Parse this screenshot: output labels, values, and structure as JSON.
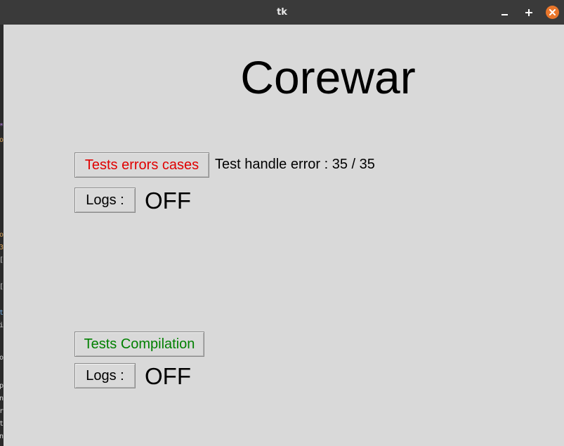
{
  "window": {
    "title": "tk",
    "controls": {
      "minimize_icon": "minimize-icon",
      "maximize_icon": "maximize-icon",
      "close_icon": "close-icon",
      "close_color": "#e9762b"
    }
  },
  "app": {
    "heading": "Corewar"
  },
  "error_tests": {
    "button_label": "Tests errors cases",
    "button_color": "#e00000",
    "result_text": "Test handle error : 35 / 35",
    "logs_button_label": "Logs :",
    "logs_state": "OFF"
  },
  "compilation_tests": {
    "button_label": "Tests Compilation",
    "button_color": "#008000",
    "logs_button_label": "Logs :",
    "logs_state": "OFF"
  }
}
